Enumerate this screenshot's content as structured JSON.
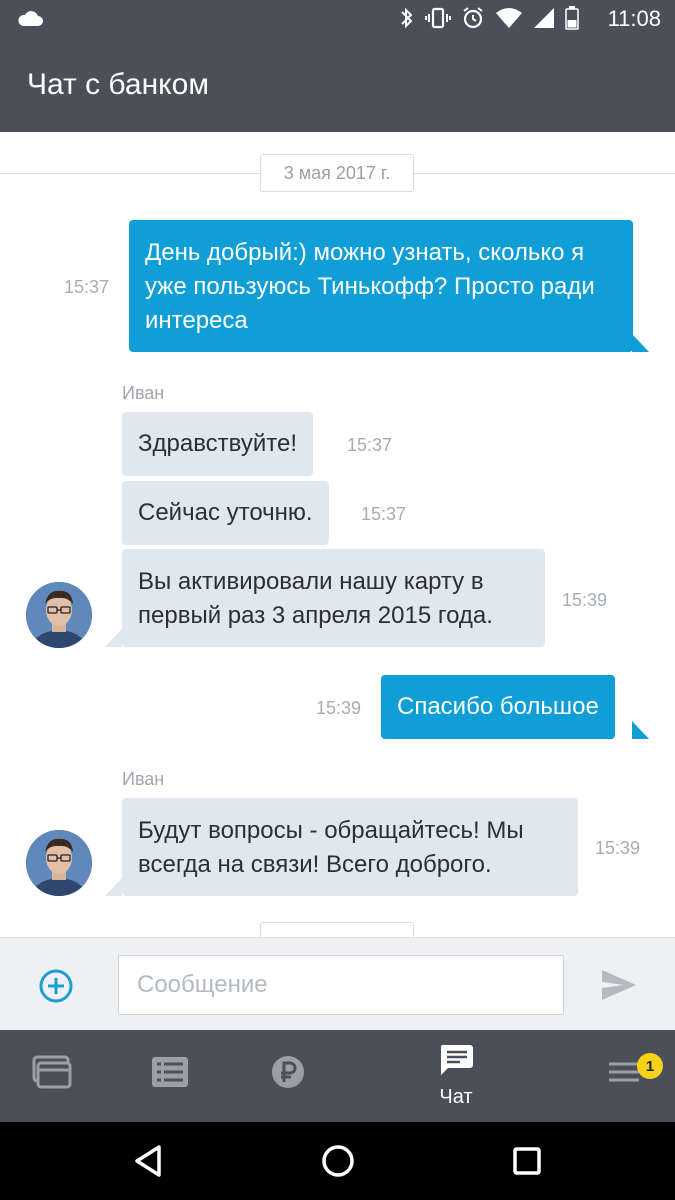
{
  "status_bar": {
    "time": "11:08",
    "icons": [
      "cloud-icon",
      "bluetooth-icon",
      "vibrate-icon",
      "alarm-icon",
      "wifi-icon",
      "battery-icon"
    ]
  },
  "app_bar": {
    "title": "Чат с банком"
  },
  "chat": {
    "date_separator": "3 мая 2017 г.",
    "messages": [
      {
        "direction": "out",
        "text": "День добрый:) можно узнать, сколько я уже пользуюсь Тинькофф? Просто ради интереса",
        "time": "15:37"
      },
      {
        "direction": "in",
        "sender": "Иван",
        "text": "Здравствуйте!",
        "time": "15:37"
      },
      {
        "direction": "in",
        "text": "Сейчас уточню.",
        "time": "15:37"
      },
      {
        "direction": "in",
        "text": "Вы активировали нашу карту в первый раз 3 апреля 2015 года.",
        "time": "15:39"
      },
      {
        "direction": "out",
        "text": "Спасибо большое",
        "time": "15:39"
      },
      {
        "direction": "in",
        "sender": "Иван",
        "text": "Будут вопросы - обращайтесь! Мы всегда на связи! Всего доброго.",
        "time": "15:39"
      }
    ]
  },
  "input": {
    "placeholder": "Сообщение"
  },
  "bottom_nav": {
    "items": [
      {
        "icon": "cards-icon",
        "label": ""
      },
      {
        "icon": "list-icon",
        "label": ""
      },
      {
        "icon": "ruble-icon",
        "label": ""
      },
      {
        "icon": "chat-icon",
        "label": "Чат",
        "active": true
      },
      {
        "icon": "menu-icon",
        "label": "",
        "badge": "1"
      }
    ]
  },
  "colors": {
    "header": "#4a4f5a",
    "outgoing_bubble": "#0f9fd6",
    "incoming_bubble": "#dfe7f0",
    "badge": "#f6d31a",
    "accent": "#1a9fd0"
  }
}
